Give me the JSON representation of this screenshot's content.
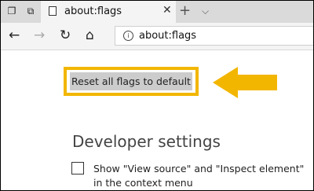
{
  "tab": {
    "title": "about:flags",
    "close_glyph": "✕"
  },
  "toolbar": {
    "new_tab_glyph": "+",
    "tab_list_glyph": "⌵"
  },
  "nav": {
    "back_glyph": "←",
    "forward_glyph": "→",
    "refresh_glyph": "↻",
    "home_glyph": "⌂"
  },
  "address_bar": {
    "info_glyph": "i",
    "url": "about:flags"
  },
  "flags": {
    "reset_label": "Reset all flags to default",
    "developer_heading": "Developer settings",
    "view_source_option": "Show \"View source\" and \"Inspect element\" in the context menu",
    "view_source_checked": false
  },
  "annotations": {
    "highlight_color": "#f2b600",
    "arrow_color": "#f2b600"
  }
}
